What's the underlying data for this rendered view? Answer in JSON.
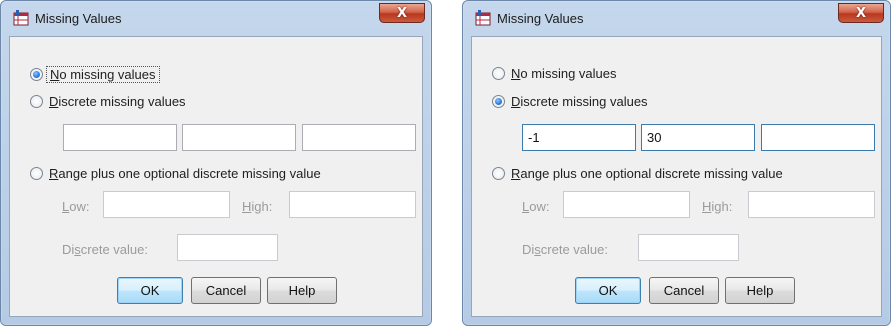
{
  "dialogs": [
    {
      "title": "Missing Values",
      "close_label": "X",
      "options": {
        "no_missing": {
          "pre": "",
          "u": "N",
          "post": "o missing values",
          "checked": true
        },
        "discrete": {
          "pre": "",
          "u": "D",
          "post": "iscrete missing values",
          "checked": false
        },
        "range": {
          "pre": "",
          "u": "R",
          "post": "ange plus one optional discrete missing value",
          "checked": false
        }
      },
      "discrete_values": [
        "",
        "",
        ""
      ],
      "low_label": {
        "pre": "",
        "u": "L",
        "post": "ow:"
      },
      "low_value": "",
      "high_label": {
        "pre": "",
        "u": "H",
        "post": "igh:"
      },
      "high_value": "",
      "discrete_value_label": {
        "pre": "Di",
        "u": "s",
        "post": "crete value:"
      },
      "discrete_value": "",
      "buttons": {
        "ok": "OK",
        "cancel": "Cancel",
        "help": "Help"
      }
    },
    {
      "title": "Missing Values",
      "close_label": "X",
      "options": {
        "no_missing": {
          "pre": "",
          "u": "N",
          "post": "o missing values",
          "checked": false
        },
        "discrete": {
          "pre": "",
          "u": "D",
          "post": "iscrete missing values",
          "checked": true
        },
        "range": {
          "pre": "",
          "u": "R",
          "post": "ange plus one optional discrete missing value",
          "checked": false
        }
      },
      "discrete_values": [
        "-1",
        "30",
        ""
      ],
      "low_label": {
        "pre": "",
        "u": "L",
        "post": "ow:"
      },
      "low_value": "",
      "high_label": {
        "pre": "",
        "u": "H",
        "post": "igh:"
      },
      "high_value": "",
      "discrete_value_label": {
        "pre": "Di",
        "u": "s",
        "post": "crete value:"
      },
      "discrete_value": "",
      "buttons": {
        "ok": "OK",
        "cancel": "Cancel",
        "help": "Help"
      }
    }
  ],
  "colors": {
    "accent": "#3c7fb1",
    "disabled_text": "#9b9b9b",
    "close_button": "#c94f33"
  }
}
